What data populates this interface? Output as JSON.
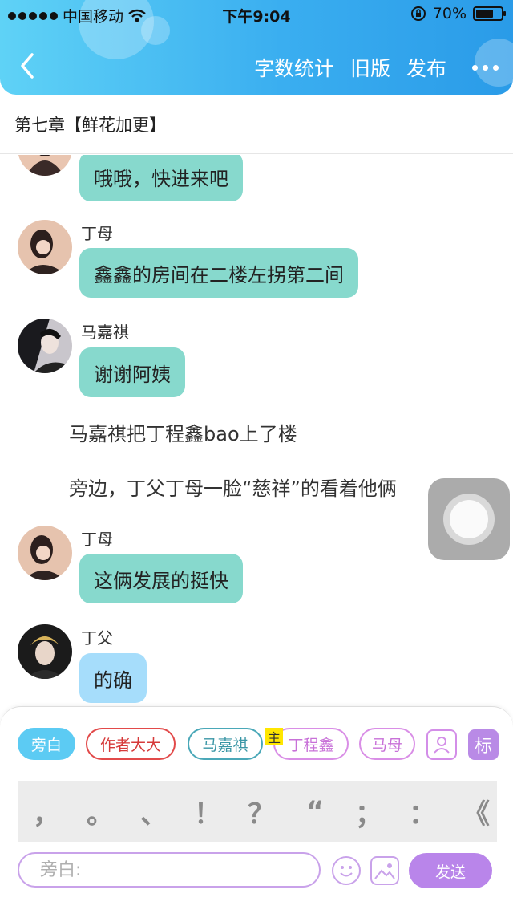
{
  "status_bar": {
    "carrier": "中国移动",
    "time": "下午9:04",
    "battery": "70%",
    "battery_level": 0.7
  },
  "nav": {
    "back_icon": "chevron-left-icon",
    "actions": [
      "字数统计",
      "旧版",
      "发布"
    ],
    "more_icon": "more-dots-icon"
  },
  "chapter_title": "第七章【鲜花加更】",
  "chat": {
    "messages": [
      {
        "speaker": "",
        "text": "哦哦，快进来吧"
      },
      {
        "speaker": "丁母",
        "text": "鑫鑫的房间在二楼左拐第二间"
      },
      {
        "speaker": "马嘉祺",
        "text": "谢谢阿姨"
      },
      {
        "narration": "马嘉祺把丁程鑫bao上了楼"
      },
      {
        "narration": "旁边，丁父丁母一脸“慈祥”的看着他俩"
      },
      {
        "speaker": "丁母",
        "text": "这俩发展的挺快"
      },
      {
        "speaker": "丁父",
        "text": "的确"
      }
    ]
  },
  "colors": {
    "accent_blue": "#3aaef0",
    "bubble_green": "#87d9cd",
    "bubble_blue": "#a6ddfb",
    "purple": "#b985ea"
  },
  "panel": {
    "roles": [
      {
        "label": "旁白",
        "color": "#5ccbf3"
      },
      {
        "label": "作者大大",
        "color": "#e24a4a"
      },
      {
        "label": "马嘉祺",
        "color": "#4aa8b8"
      },
      {
        "label": "丁程鑫",
        "color": "#d98ee6"
      },
      {
        "label": "马母",
        "color": "#d98ee6"
      }
    ],
    "main_badge": "主",
    "tag_button": "标",
    "punctuation": [
      "，",
      "。",
      "、",
      "！",
      "？",
      "“",
      "；",
      "：",
      "《"
    ],
    "input_placeholder": "旁白:",
    "send_label": "发送"
  }
}
